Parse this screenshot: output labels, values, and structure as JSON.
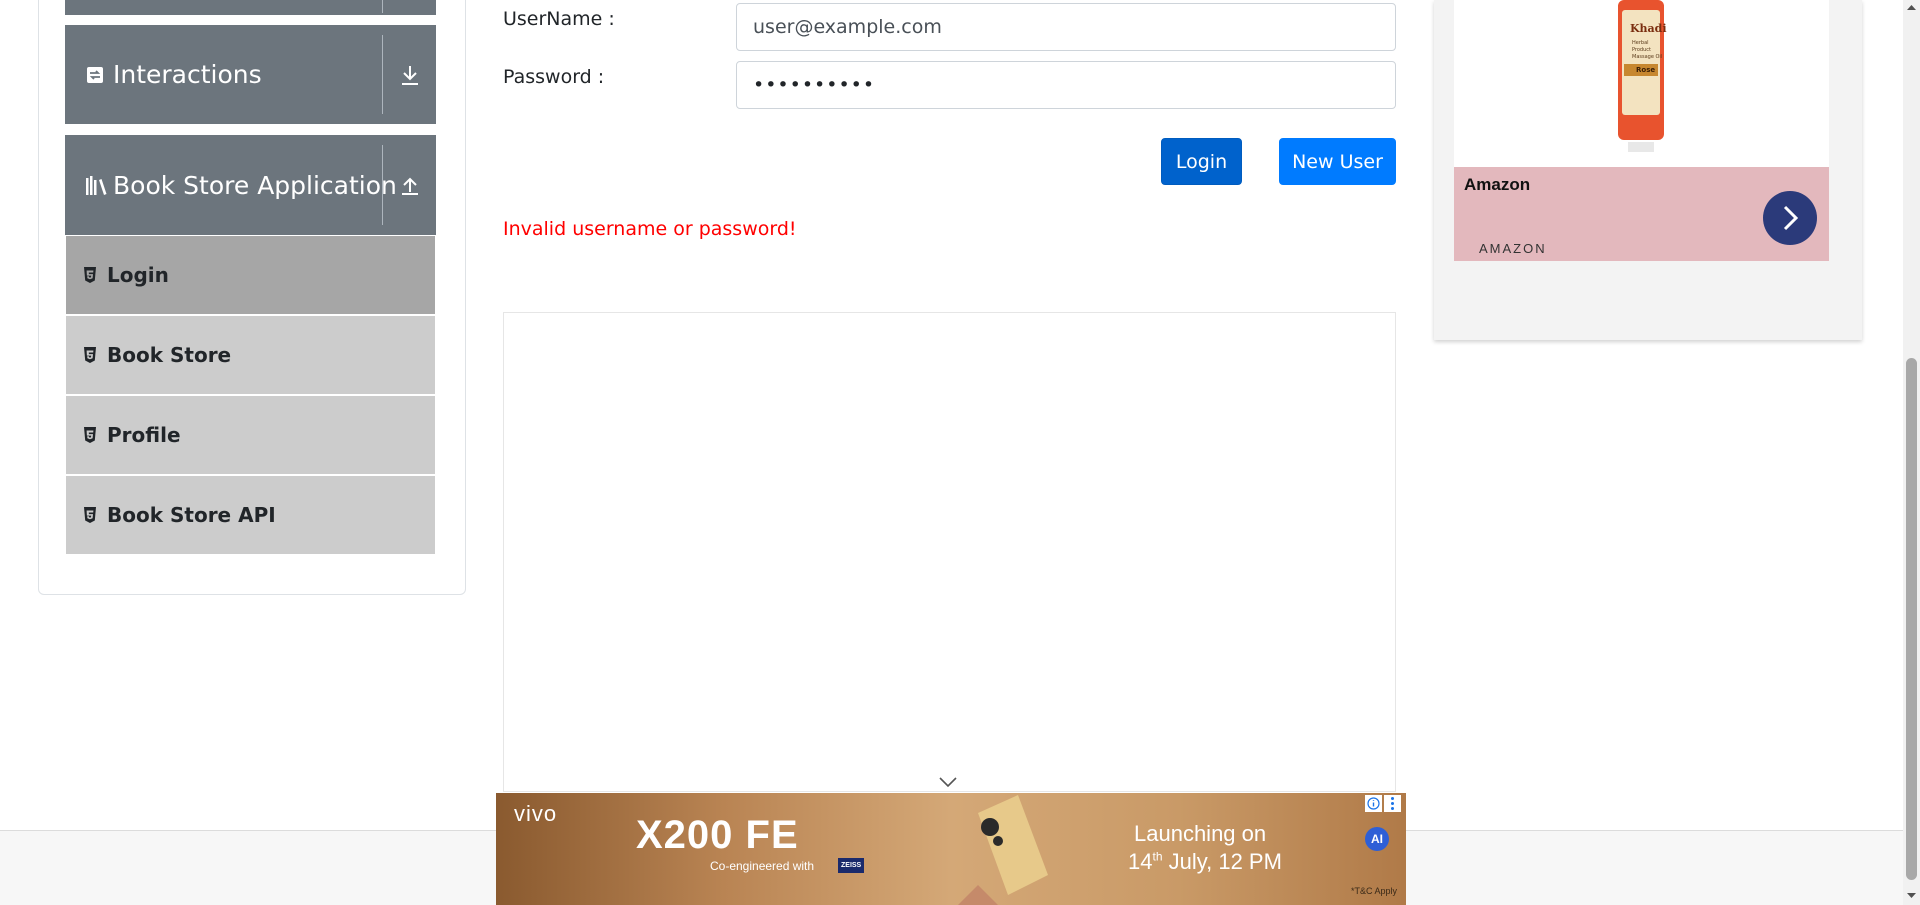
{
  "sidebar": {
    "groups": [
      {
        "label": "Interactions",
        "icon": "repeat-icon",
        "toggle_icon": "arrow-down-icon"
      },
      {
        "label": "Book Store Application",
        "icon": "books-icon",
        "toggle_icon": "arrow-up-icon"
      }
    ],
    "items": [
      {
        "label": "Login",
        "active": true,
        "icon": "html5-icon"
      },
      {
        "label": "Book Store",
        "active": false,
        "icon": "html5-icon"
      },
      {
        "label": "Profile",
        "active": false,
        "icon": "html5-icon"
      },
      {
        "label": "Book Store API",
        "active": false,
        "icon": "html5-icon"
      }
    ]
  },
  "form": {
    "username_label": "UserName :",
    "username_value": "user@example.com",
    "password_label": "Password :",
    "password_value": "••••••••••",
    "login_button": "Login",
    "new_user_button": "New User",
    "error_message": "Invalid username or password!"
  },
  "right_ad": {
    "product_brand": "Khadi",
    "product_lines": [
      "Herbal",
      "Product",
      "Massage Oil"
    ],
    "product_variant": "Rose",
    "advertiser": "Amazon",
    "advertiser_caption": "AMAZON",
    "cta_icon": "chevron-right-icon"
  },
  "bottom_ad": {
    "brand": "vivo",
    "model": "X200 FE",
    "tagline": "Co-engineered with",
    "partner": "ZEISS",
    "launch_line1": "Launching on",
    "launch_day": "14",
    "launch_suffix": "th",
    "launch_line2": " July, 12 PM",
    "terms": "*T&C Apply",
    "badge": "AI"
  },
  "colors": {
    "group_header": "#6c757d",
    "menu_item": "#cccccc",
    "menu_item_active": "#a6a6a6",
    "login_button": "#0062cc",
    "new_user_button": "#007bff",
    "error_text": "#ff0000"
  }
}
